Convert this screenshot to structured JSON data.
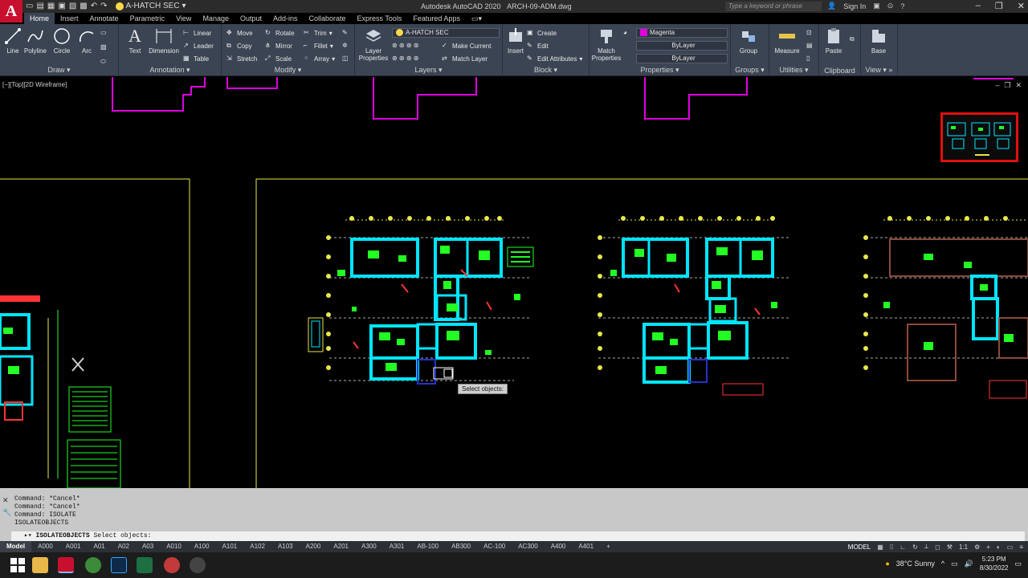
{
  "app": {
    "title": "Autodesk AutoCAD 2020",
    "filename": "ARCH-09-ADM.dwg",
    "qat_layer": "A-HATCH SEC",
    "search_placeholder": "Type a keyword or phrase",
    "sign_in": "Sign In"
  },
  "tabs": [
    "Home",
    "Insert",
    "Annotate",
    "Parametric",
    "View",
    "Manage",
    "Output",
    "Add-ins",
    "Collaborate",
    "Express Tools",
    "Featured Apps"
  ],
  "ribbon": {
    "draw": {
      "title": "Draw",
      "tools": [
        "Line",
        "Polyline",
        "Circle",
        "Arc"
      ]
    },
    "annotation": {
      "title": "Annotation",
      "text": "Text",
      "dimension": "Dimension",
      "linear": "Linear",
      "leader": "Leader",
      "table": "Table"
    },
    "modify": {
      "title": "Modify",
      "move": "Move",
      "rotate": "Rotate",
      "trim": "Trim",
      "copy": "Copy",
      "mirror": "Mirror",
      "fillet": "Fillet",
      "stretch": "Stretch",
      "scale": "Scale",
      "array": "Array"
    },
    "layers": {
      "title": "Layers",
      "layer_properties": "Layer Properties",
      "current_layer": "A-HATCH SEC",
      "make_current": "Make Current",
      "match_layer": "Match Layer"
    },
    "block": {
      "title": "Block",
      "insert": "Insert",
      "create": "Create",
      "edit": "Edit",
      "edit_attributes": "Edit Attributes"
    },
    "properties": {
      "title": "Properties",
      "match_properties": "Match Properties",
      "color": "Magenta",
      "linetype": "ByLayer",
      "lineweight": "ByLayer"
    },
    "groups": {
      "title": "Groups",
      "group": "Group"
    },
    "utilities": {
      "title": "Utilities",
      "measure": "Measure"
    },
    "clipboard": {
      "title": "Clipboard",
      "paste": "Paste"
    },
    "view": {
      "title": "View",
      "base": "Base"
    }
  },
  "viewport": {
    "label": "[−][Top][2D Wireframe]",
    "tooltip": "Select objects:"
  },
  "command": {
    "history": [
      "Command: *Cancel*",
      "Command: *Cancel*",
      "Command: ISOLATE",
      "ISOLATEOBJECTS"
    ],
    "current_cmd": "ISOLATEOBJECTS",
    "prompt": "Select objects:"
  },
  "layout_tabs": [
    "Model",
    "A000",
    "A001",
    "A01",
    "A02",
    "A03",
    "A010",
    "A100",
    "A101",
    "A102",
    "A103",
    "A200",
    "A201",
    "A300",
    "A301",
    "AB-100",
    "AB300",
    "AC-100",
    "AC300",
    "A400",
    "A401",
    "+"
  ],
  "status": {
    "model": "MODEL",
    "scale": "1:1"
  },
  "taskbar": {
    "weather": "38°C Sunny",
    "time": "5:23 PM",
    "date": "8/30/2022"
  },
  "colors": {
    "cyan": "#00e5ff",
    "green": "#22ff22",
    "magenta": "#e000e0",
    "yellow": "#e8e84a",
    "ribbon": "#3b4453"
  }
}
